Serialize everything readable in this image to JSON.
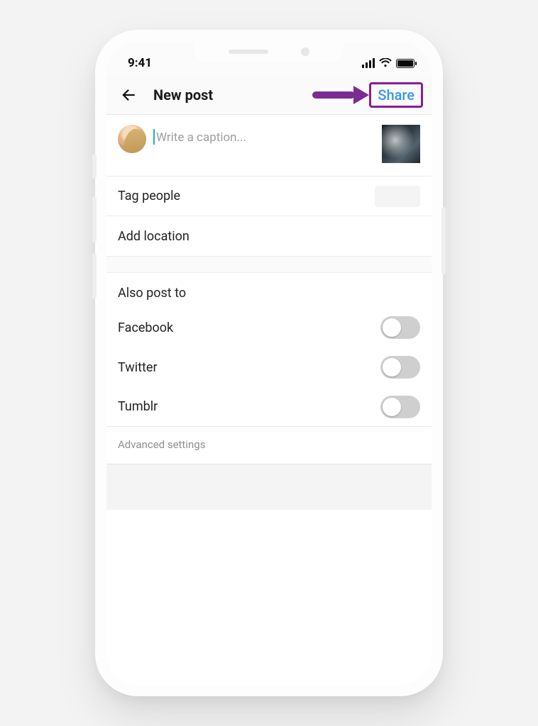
{
  "statusbar": {
    "time": "9:41"
  },
  "navbar": {
    "title": "New post",
    "share_label": "Share"
  },
  "caption": {
    "placeholder": "Write a caption..."
  },
  "rows": {
    "tag_people": "Tag people",
    "add_location": "Add location"
  },
  "also_post": {
    "header": "Also post to",
    "options": {
      "facebook": "Facebook",
      "twitter": "Twitter",
      "tumblr": "Tumblr"
    }
  },
  "advanced_label": "Advanced settings",
  "toggles": {
    "facebook": false,
    "twitter": false,
    "tumblr": false
  },
  "colors": {
    "accent": "#3897f0",
    "highlight": "#8c1a9e",
    "caret": "#1fb5a6"
  }
}
